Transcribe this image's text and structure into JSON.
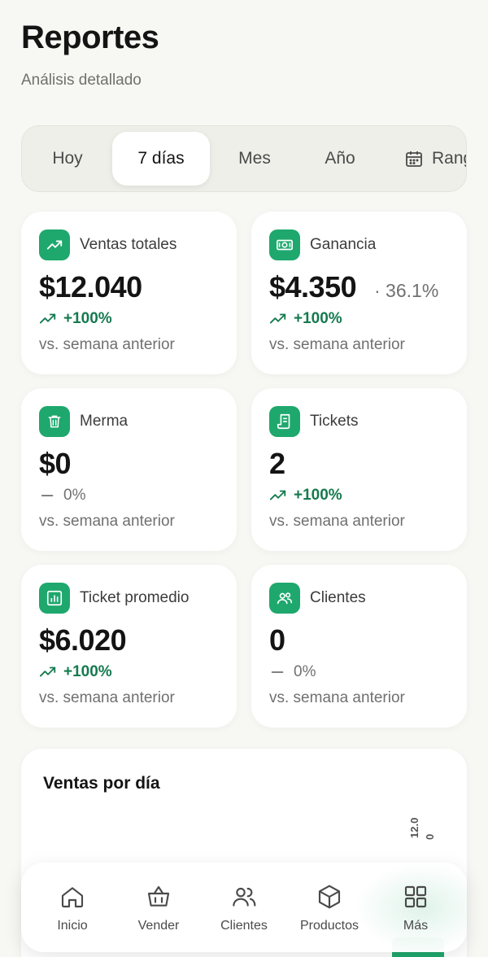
{
  "header": {
    "title": "Reportes",
    "subtitle": "Análisis detallado"
  },
  "periods": [
    {
      "label": "Hoy",
      "active": false
    },
    {
      "label": "7 días",
      "active": true
    },
    {
      "label": "Mes",
      "active": false
    },
    {
      "label": "Año",
      "active": false
    },
    {
      "label": "Rango",
      "active": false,
      "icon": "calendar-icon"
    }
  ],
  "cards": [
    {
      "label": "Ventas totales",
      "value": "$12.040",
      "change": "+100%",
      "trend": "up",
      "note": "vs. semana anterior",
      "icon": "trending-up-icon"
    },
    {
      "label": "Ganancia",
      "value": "$4.350",
      "extra": "· 36.1%",
      "change": "+100%",
      "trend": "up",
      "note": "vs. semana anterior",
      "icon": "banknote-icon"
    },
    {
      "label": "Merma",
      "value": "$0",
      "change": "0%",
      "trend": "flat",
      "note": "vs. semana anterior",
      "icon": "trash-icon"
    },
    {
      "label": "Tickets",
      "value": "2",
      "change": "+100%",
      "trend": "up",
      "note": "vs. semana anterior",
      "icon": "receipt-icon"
    },
    {
      "label": "Ticket promedio",
      "value": "$6.020",
      "change": "+100%",
      "trend": "up",
      "note": "vs. semana anterior",
      "icon": "bar-chart-icon"
    },
    {
      "label": "Clientes",
      "value": "0",
      "change": "0%",
      "trend": "flat",
      "note": "vs. semana anterior",
      "icon": "users-icon"
    }
  ],
  "sales_chart": {
    "title": "Ventas por día",
    "bar_labels": [
      "12.0",
      "0"
    ]
  },
  "nav": [
    {
      "label": "Inicio",
      "icon": "home-icon",
      "active": false
    },
    {
      "label": "Vender",
      "icon": "basket-icon",
      "active": false
    },
    {
      "label": "Clientes",
      "icon": "users-icon",
      "active": false
    },
    {
      "label": "Productos",
      "icon": "box-icon",
      "active": false
    },
    {
      "label": "Más",
      "icon": "grid-icon",
      "active": true
    }
  ],
  "colors": {
    "accent": "#1ea86d",
    "positive": "#157a4f",
    "background": "#f7f7f3"
  }
}
